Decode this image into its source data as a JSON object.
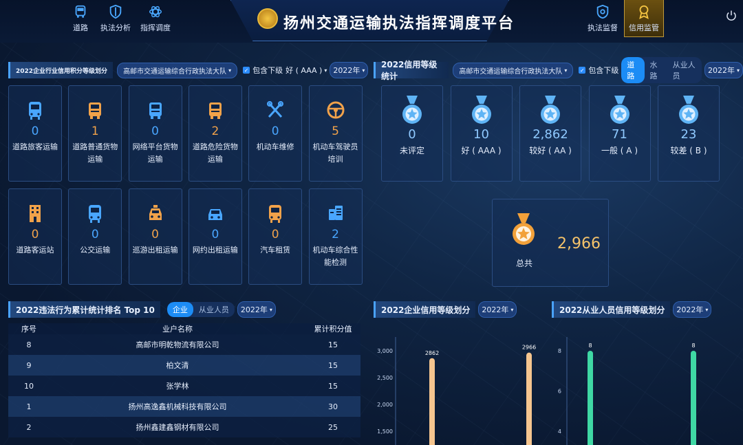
{
  "header": {
    "title": "扬州交通运输执法指挥调度平台",
    "nav_left": [
      {
        "label": "道路",
        "icon": "truck-icon"
      },
      {
        "label": "执法分析",
        "icon": "shield-icon"
      },
      {
        "label": "指挥调度",
        "icon": "atom-icon"
      }
    ],
    "nav_right": [
      {
        "label": "执法监督",
        "icon": "badge-icon"
      },
      {
        "label": "信用监管",
        "icon": "medal-icon",
        "active": true
      }
    ]
  },
  "industry_panel": {
    "title": "2022企业行业信用积分等级划分",
    "org_select": "高邮市交通运输综合行政执法大队",
    "include_sub": "包含下级",
    "level_select": "好 ( AAA )",
    "year_select": "2022年",
    "cards": [
      {
        "value": "0",
        "label": "道路旅客运输",
        "icon": "bus-icon",
        "color": "#49a6ff"
      },
      {
        "value": "1",
        "label": "道路普通货物运输",
        "icon": "truck-icon",
        "color": "#f1a24a"
      },
      {
        "value": "0",
        "label": "网络平台货物运输",
        "icon": "truck-icon",
        "color": "#49a6ff"
      },
      {
        "value": "2",
        "label": "道路危险货物运输",
        "icon": "truck-icon",
        "color": "#f1a24a"
      },
      {
        "value": "0",
        "label": "机动车维修",
        "icon": "wrench-icon",
        "color": "#49a6ff"
      },
      {
        "value": "5",
        "label": "机动车驾驶员培训",
        "icon": "steering-wheel-icon",
        "color": "#f1a24a"
      },
      {
        "value": "0",
        "label": "道路客运站",
        "icon": "building-icon",
        "color": "#f1a24a"
      },
      {
        "value": "0",
        "label": "公交运输",
        "icon": "bus-icon",
        "color": "#49a6ff"
      },
      {
        "value": "0",
        "label": "巡游出租运输",
        "icon": "taxi-icon",
        "color": "#f1a24a"
      },
      {
        "value": "0",
        "label": "网约出租运输",
        "icon": "car-icon",
        "color": "#49a6ff"
      },
      {
        "value": "0",
        "label": "汽车租赁",
        "icon": "bus-icon",
        "color": "#f1a24a"
      },
      {
        "value": "2",
        "label": "机动车综合性能检测",
        "icon": "clipboard-icon",
        "color": "#49a6ff"
      }
    ]
  },
  "credit_panel": {
    "title": "2022信用等级统计",
    "org_select": "高邮市交通运输综合行政执法大队",
    "include_sub": "包含下级",
    "tabs": [
      "道路",
      "水路",
      "从业人员"
    ],
    "active_tab": "道路",
    "year_select": "2022年",
    "medals": [
      {
        "value": "0",
        "label": "未评定"
      },
      {
        "value": "10",
        "label": "好 ( AAA )"
      },
      {
        "value": "2,862",
        "label": "较好 ( AA )"
      },
      {
        "value": "71",
        "label": "一般 ( A )"
      },
      {
        "value": "23",
        "label": "较差 ( B )"
      }
    ],
    "total_label": "总共",
    "total_value": "2,966"
  },
  "ranking_panel": {
    "title": "2022违法行为累计统计排名 Top 10",
    "tabs": [
      "企业",
      "从业人员"
    ],
    "active_tab": "企业",
    "year_select": "2022年",
    "columns": [
      "序号",
      "业户名称",
      "累计积分值"
    ],
    "rows": [
      [
        "8",
        "高邮市明乾物流有限公司",
        "15"
      ],
      [
        "9",
        "柏文清",
        "15"
      ],
      [
        "10",
        "张学林",
        "15"
      ],
      [
        "1",
        "扬州高逸鑫机械科技有限公司",
        "30"
      ],
      [
        "2",
        "扬州鑫建鑫钢材有限公司",
        "25"
      ]
    ]
  },
  "enterprise_chart": {
    "title": "2022企业信用等级划分",
    "year_select": "2022年"
  },
  "practitioner_chart": {
    "title": "2022从业人员信用等级划分",
    "year_select": "2022年"
  },
  "chart_data": [
    {
      "type": "bar",
      "title": "2022企业信用等级划分",
      "values": [
        2862,
        2966
      ],
      "data_labels": [
        "2862",
        "2966"
      ],
      "y_ticks": [
        "3,000",
        "2,500",
        "2,000",
        "1,500"
      ],
      "ylim": [
        1500,
        3000
      ],
      "bar_color": "#f5c58f"
    },
    {
      "type": "bar",
      "title": "2022从业人员信用等级划分",
      "values": [
        8,
        8
      ],
      "data_labels": [
        "8",
        "8"
      ],
      "y_ticks": [
        "8",
        "6",
        "4"
      ],
      "ylim": [
        4,
        8
      ],
      "bar_color": "#3fd8a4"
    }
  ]
}
